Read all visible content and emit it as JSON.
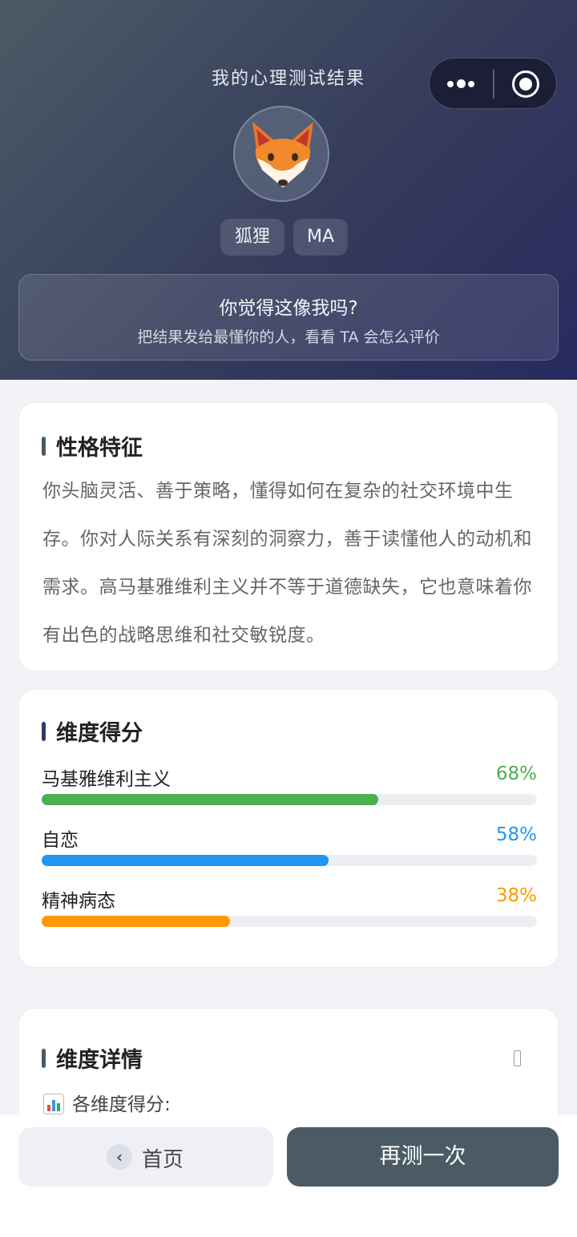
{
  "header": {
    "title": "我的心理测试结果",
    "avatar": "fox-emoji",
    "tags": [
      "狐狸",
      "MA"
    ],
    "share": {
      "title": "你觉得这像我吗?",
      "subtitle": "把结果发给最懂你的人，看看 TA 会怎么评价"
    }
  },
  "capsule": {
    "more_icon": "more-dots-icon",
    "close_icon": "target-close-icon"
  },
  "traits": {
    "title": "性格特征",
    "description": "你头脑灵活、善于策略，懂得如何在复杂的社交环境中生存。你对人际关系有深刻的洞察力，善于读懂他人的动机和需求。高马基雅维利主义并不等于道德缺失，它也意味着你有出色的战略思维和社交敏锐度。"
  },
  "scores": {
    "title": "维度得分",
    "items": [
      {
        "label": "马基雅维利主义",
        "value": 68,
        "display": "68%",
        "color": "#4caf50"
      },
      {
        "label": "自恋",
        "value": 58,
        "display": "58%",
        "color": "#2196f3"
      },
      {
        "label": "精神病态",
        "value": 38,
        "display": "38%",
        "color": "#ff9800"
      }
    ]
  },
  "details": {
    "title": "维度详情",
    "subtitle": "各维度得分:"
  },
  "bottom": {
    "home_label": "首页",
    "retry_label": "再测一次"
  }
}
